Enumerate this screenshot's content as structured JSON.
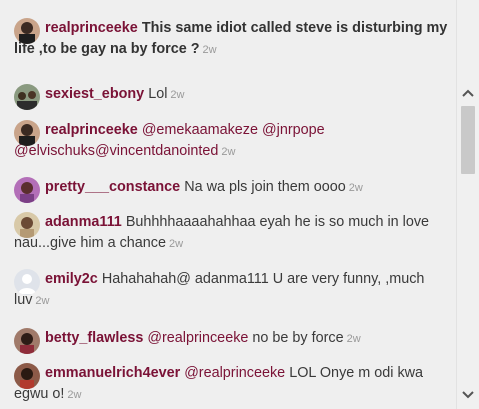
{
  "comments": [
    {
      "username": "realprinceeke",
      "text": "This same idiot called steve is disturbing my life ,to be gay na by force ?",
      "time": "2w",
      "avatar": "avatar-dark-man"
    },
    {
      "username": "sexiest_ebony",
      "text": "Lol",
      "time": "2w",
      "avatar": "avatar-group"
    },
    {
      "username": "realprinceeke",
      "mention1": "@emekaamakeze",
      "mention2": "@jnrpope",
      "mention3": "@elvischuks@vincentdanointed",
      "time": "2w",
      "avatar": "avatar-dark-man"
    },
    {
      "username": "pretty___constance",
      "text": "Na wa pls join them oooo",
      "time": "2w",
      "avatar": "avatar-woman-purple"
    },
    {
      "username": "adanma111",
      "text": "Buhhhhaaaahahhaa eyah he is so much in love nau...give him a chance",
      "time": "2w",
      "avatar": "avatar-woman-light"
    },
    {
      "username": "emily2c",
      "text": "Hahahahah@ adanma111 U are very funny, ,much luv",
      "time": "2w",
      "avatar": "avatar-default-silhouette"
    },
    {
      "username": "betty_flawless",
      "mention": "@realprinceeke",
      "text": "no be by force",
      "time": "2w",
      "avatar": "avatar-woman-dark"
    },
    {
      "username": "emmanuelrich4ever",
      "mention": "@realprinceeke",
      "text": "LOL Onye m odi kwa egwu o!",
      "time": "2w",
      "avatar": "avatar-man-red"
    }
  ],
  "scrollbar": {
    "up_icon": "chevron-up-icon",
    "down_icon": "chevron-down-icon"
  },
  "colors": {
    "username": "#7a1236",
    "text": "#3a3a3a",
    "timestamp": "#9a9a9a",
    "background": "#efefef"
  }
}
